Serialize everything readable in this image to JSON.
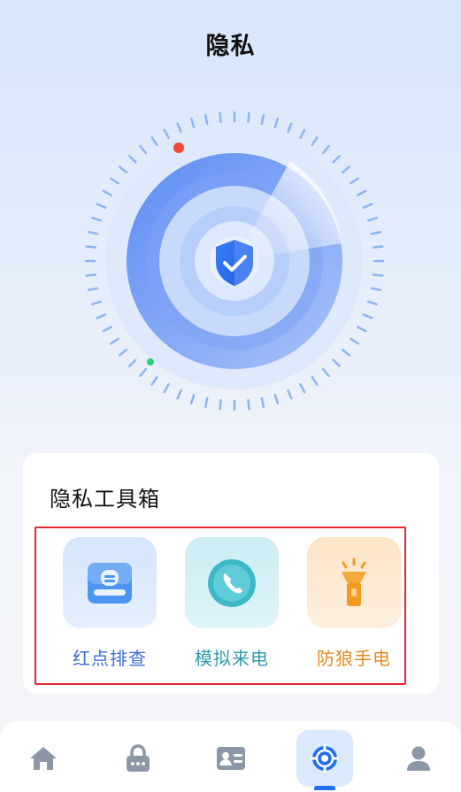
{
  "header": {
    "title": "隐私"
  },
  "scanner": {
    "shield_icon": "shield-check-icon",
    "colors": {
      "primary": "#4f7ff5",
      "alert_dot": "#f04a3a",
      "ok_dot": "#2ad17a",
      "tick": "#8db5f2"
    }
  },
  "toolbox": {
    "title": "隐私工具箱",
    "tools": [
      {
        "label": "红点排查",
        "icon": "camera-detector-icon"
      },
      {
        "label": "模拟来电",
        "icon": "phone-call-icon"
      },
      {
        "label": "防狼手电",
        "icon": "flashlight-icon"
      }
    ]
  },
  "tabbar": {
    "tabs": [
      {
        "icon": "home-icon",
        "active": false
      },
      {
        "icon": "lock-icon",
        "active": false
      },
      {
        "icon": "id-card-icon",
        "active": false
      },
      {
        "icon": "privacy-target-icon",
        "active": true
      },
      {
        "icon": "user-icon",
        "active": false
      }
    ],
    "active_color": "#1f6ff0",
    "inactive_color": "#8b96a6"
  }
}
